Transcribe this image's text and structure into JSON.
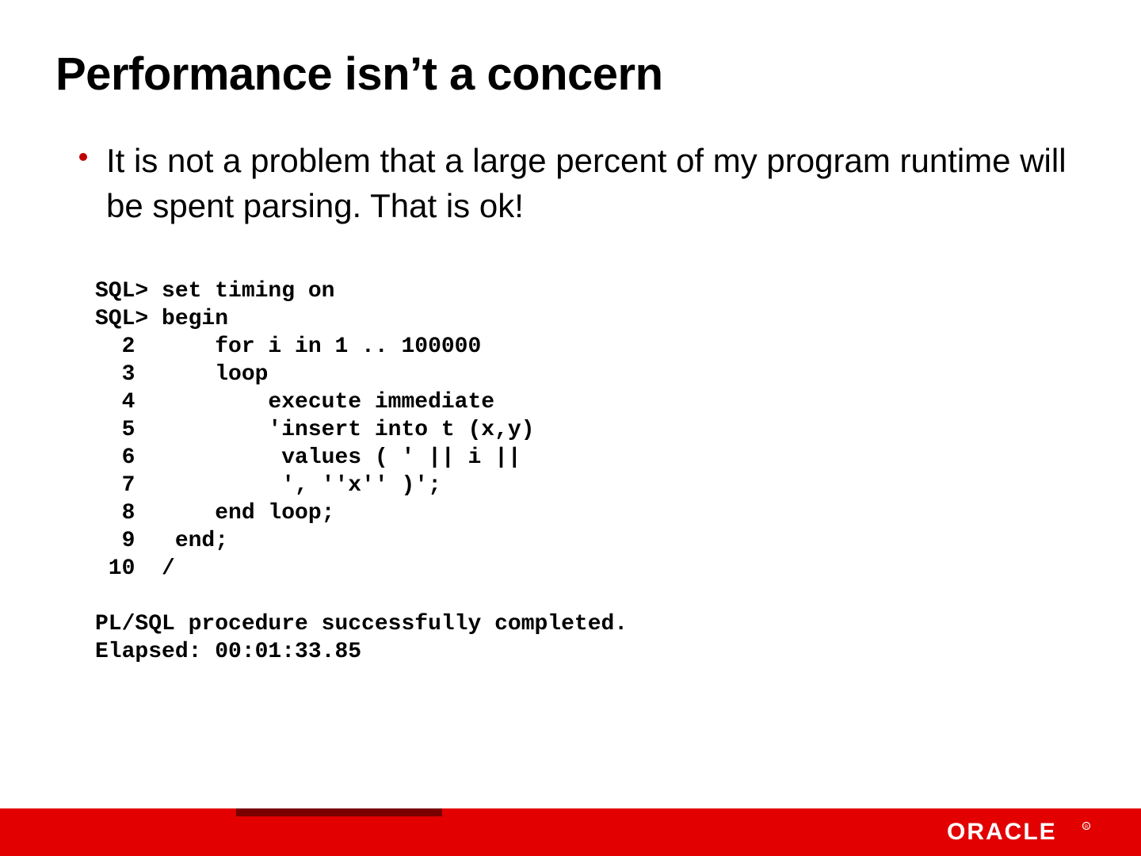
{
  "title": "Performance isn’t a concern",
  "bullet": "It is not a problem that a large percent of my program runtime will be spent parsing.  That is ok!",
  "code": "SQL> set timing on\nSQL> begin\n  2      for i in 1 .. 100000\n  3      loop\n  4          execute immediate\n  5          'insert into t (x,y)\n  6           values ( ' || i ||\n  7           ', ''x'' )';\n  8      end loop;\n  9   end;\n 10  /\n\nPL/SQL procedure successfully completed.\nElapsed: 00:01:33.85",
  "logo_text": "ORACLE",
  "colors": {
    "accent_red": "#e20000",
    "bullet_red": "#c00000",
    "footer_dark": "#7a0000",
    "text": "#000000",
    "bg": "#ffffff"
  }
}
